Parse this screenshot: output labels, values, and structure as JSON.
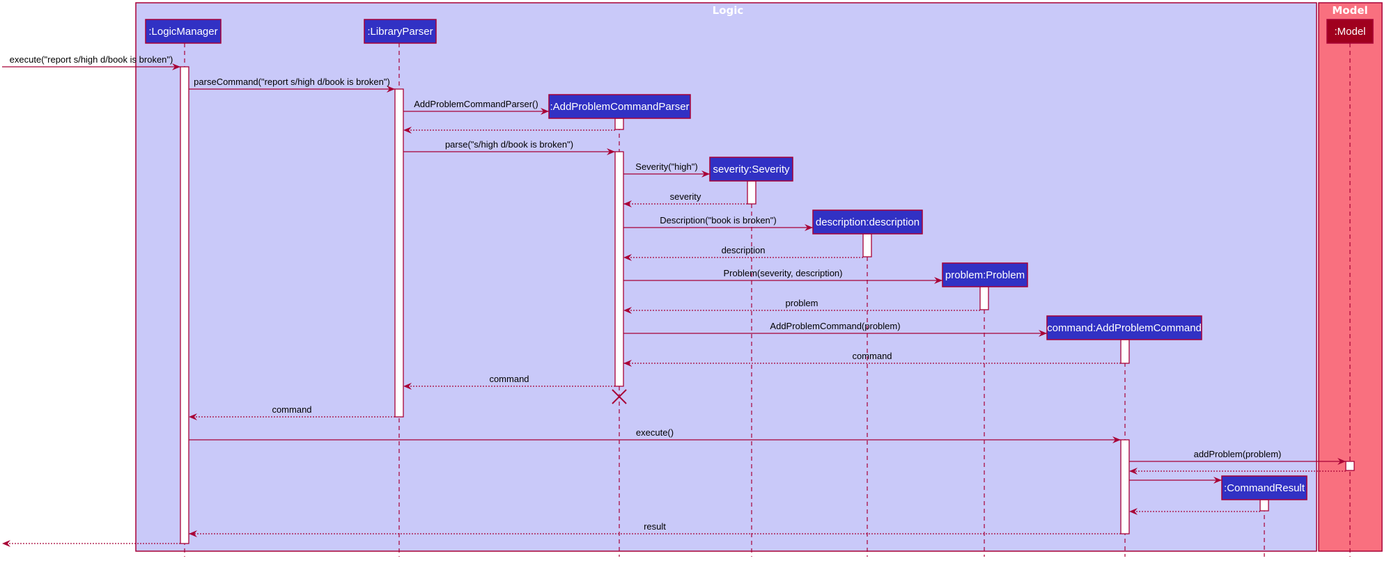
{
  "frames": [
    {
      "id": "logic",
      "title": "Logic"
    },
    {
      "id": "model",
      "title": "Model"
    }
  ],
  "participants": [
    {
      "id": "lm",
      "label": ":LogicManager",
      "frame": "logic"
    },
    {
      "id": "lp",
      "label": ":LibraryParser",
      "frame": "logic"
    },
    {
      "id": "apcp",
      "label": ":AddProblemCommandParser",
      "frame": "logic",
      "created": true,
      "destroyed": true
    },
    {
      "id": "sev",
      "label": "severity:Severity",
      "frame": "logic",
      "created": true
    },
    {
      "id": "desc",
      "label": "description:description",
      "frame": "logic",
      "created": true
    },
    {
      "id": "prob",
      "label": "problem:Problem",
      "frame": "logic",
      "created": true
    },
    {
      "id": "cmd",
      "label": "command:AddProblemCommand",
      "frame": "logic",
      "created": true
    },
    {
      "id": "cr",
      "label": ":CommandResult",
      "frame": "logic",
      "created": true
    },
    {
      "id": "model",
      "label": ":Model",
      "frame": "model"
    }
  ],
  "messages": [
    {
      "from": "external",
      "to": "lm",
      "label": "execute(\"report s/high d/book is broken\")",
      "type": "call"
    },
    {
      "from": "lm",
      "to": "lp",
      "label": "parseCommand(\"report s/high d/book is broken\")",
      "type": "call"
    },
    {
      "from": "lp",
      "to": "apcp",
      "label": "AddProblemCommandParser()",
      "type": "create"
    },
    {
      "from": "apcp",
      "to": "lp",
      "label": "",
      "type": "return"
    },
    {
      "from": "lp",
      "to": "apcp",
      "label": "parse(\"s/high d/book is broken\")",
      "type": "call"
    },
    {
      "from": "apcp",
      "to": "sev",
      "label": "Severity(\"high\")",
      "type": "create"
    },
    {
      "from": "sev",
      "to": "apcp",
      "label": "severity",
      "type": "return"
    },
    {
      "from": "apcp",
      "to": "desc",
      "label": "Description(\"book is broken\")",
      "type": "create"
    },
    {
      "from": "desc",
      "to": "apcp",
      "label": "description",
      "type": "return"
    },
    {
      "from": "apcp",
      "to": "prob",
      "label": "Problem(severity, description)",
      "type": "create"
    },
    {
      "from": "prob",
      "to": "apcp",
      "label": "problem",
      "type": "return"
    },
    {
      "from": "apcp",
      "to": "cmd",
      "label": "AddProblemCommand(problem)",
      "type": "create"
    },
    {
      "from": "cmd",
      "to": "apcp",
      "label": "command",
      "type": "return"
    },
    {
      "from": "apcp",
      "to": "lp",
      "label": "command",
      "type": "return"
    },
    {
      "from": "lp",
      "to": "lm",
      "label": "command",
      "type": "return"
    },
    {
      "from": "lm",
      "to": "cmd",
      "label": "execute()",
      "type": "call"
    },
    {
      "from": "cmd",
      "to": "model",
      "label": "addProblem(problem)",
      "type": "call"
    },
    {
      "from": "model",
      "to": "cmd",
      "label": "",
      "type": "return"
    },
    {
      "from": "cmd",
      "to": "cr",
      "label": "",
      "type": "create"
    },
    {
      "from": "cr",
      "to": "cmd",
      "label": "",
      "type": "return"
    },
    {
      "from": "cmd",
      "to": "lm",
      "label": "result",
      "type": "return"
    },
    {
      "from": "lm",
      "to": "external",
      "label": "",
      "type": "return"
    }
  ],
  "colors": {
    "logic_frame": "#c9c9f9",
    "model_frame": "#f9707f",
    "participant": "#3131c4",
    "model_participant": "#a0001e",
    "line": "#a80036"
  }
}
